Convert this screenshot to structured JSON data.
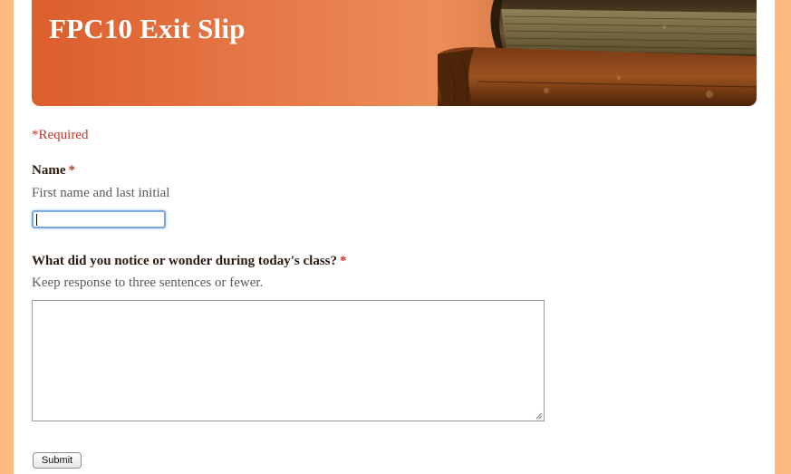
{
  "form": {
    "title": "FPC10 Exit Slip",
    "required_note": "*Required",
    "submit_label": "Submit"
  },
  "questions": [
    {
      "title": "Name",
      "required_marker": "*",
      "help": "First name and last initial",
      "value": "",
      "input_type": "text"
    },
    {
      "title": "What did you notice or wonder during today's class?",
      "required_marker": "*",
      "help": "Keep response to three sentences or fewer.",
      "value": "",
      "input_type": "paragraph"
    }
  ],
  "colors": {
    "outer_background": "#FDBB80",
    "banner_orange": "#DC5E2C",
    "required_red": "#C0392B",
    "focus_blue": "#7BA7DB"
  },
  "icons": {
    "banner_image": "old-books-stack",
    "textarea_grip": "resize-grip-icon"
  }
}
